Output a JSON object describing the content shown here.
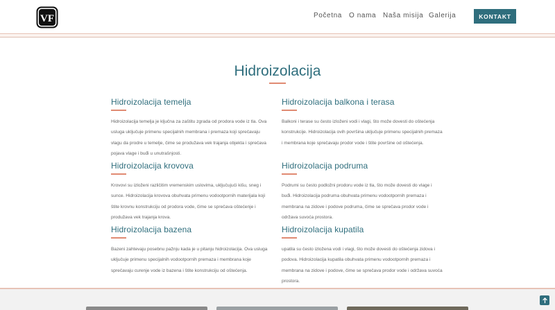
{
  "header": {
    "logo_text": "VF",
    "nav": [
      "Početna",
      "O nama",
      "Naša misija",
      "Galerija"
    ],
    "cta_label": "KONTAKT"
  },
  "main": {
    "title": "Hidroizolacija",
    "sections": [
      {
        "heading": "Hidroizolacija temelja",
        "text": "Hidroizolacija temelja je ključna za zaštitu zgrada od prodora vode iz tla. Ova usluga uključuje primenu specijalnih membrana i premaza koji sprečavaju vlagu da prodre u temelje, čime se produžava vek trajanja objekta i sprečava pojava vlage i buđi u unutrašnjosti."
      },
      {
        "heading": "Hidroizolacija balkona i terasa",
        "text": "Balkoni i terase su često izloženi vodi i vlagi, što može dovesti do oštećenja konstrukcije. Hidroizolacija ovih površina uključuje primenu specijalnih premaza i membrana koje sprečavaju prodor vode i štite površine od oštećenja."
      },
      {
        "heading": "Hidroizolacija krovova",
        "text": "Krovovi su izloženi različitim vremenskim uslovima, uključujući kišu, sneg i sunce. Hidroizolacija krovova obuhvata primenu vodootpornih materijala koji štite krovnu konstrukciju od prodora vode, čime se sprečava oštećenje i produžava vek trajanja krova."
      },
      {
        "heading": "Hidroizolacija podruma",
        "text": "Podrumi su često podložni prodoru vode iz tla, što može dovesti do vlage i buđi. Hidroizolacija podruma obuhvata primenu vodootpornih premaza i membrana na zidove i podove podruma, čime se sprečava prodor vode i održava suvoća prostora."
      },
      {
        "heading": "Hidroizolacija bazena",
        "text": "Bazeni zahtevaju posebnu pažnju kada je u pitanju hidroizolacija. Ova usluga uključuje primenu specijalnih vodootpornih premaza i membrana koje sprečavaju curenje vode iz bazena i štite konstrukciju od oštećenja."
      },
      {
        "heading": "Hidroizolacija kupatila",
        "text": "upatila su često izložena vodi i vlagi, što može dovesti do oštećenja zidova i podova. Hidroizolacija kupatila obuhvata primenu vodootpornih premaza i membrana na zidove i podove, čime se sprečava prodor vode i održava suvoća prostora."
      }
    ]
  },
  "colors": {
    "accent": "#2f6e7d",
    "rule": "#e08a72"
  },
  "icons": {
    "scroll_top": "arrow-up-icon"
  }
}
